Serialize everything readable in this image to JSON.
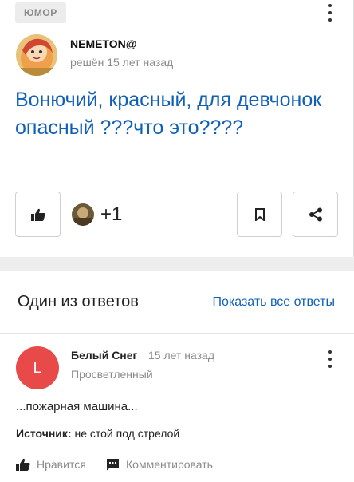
{
  "question": {
    "category": "Юмор",
    "author": "NEMETON@",
    "status": "решён 15 лет назад",
    "title": "Вонючий, красный, для девчонок опасный ???что это????",
    "likes": "+1"
  },
  "answers": {
    "heading": "Один из ответов",
    "show_all": "Показать все ответы",
    "item": {
      "avatar_letter": "L",
      "author": "Белый Снег",
      "time": "15 лет назад",
      "rank": "Просветленный",
      "text": "...пожарная машина...",
      "source_label": "Источник:",
      "source_value": "не стой под стрелой",
      "like_label": "Нравится",
      "comment_label": "Комментировать"
    }
  },
  "colors": {
    "link_blue": "#1060b8",
    "avatar_red": "#e84a4a",
    "muted": "#8b8b8b"
  }
}
